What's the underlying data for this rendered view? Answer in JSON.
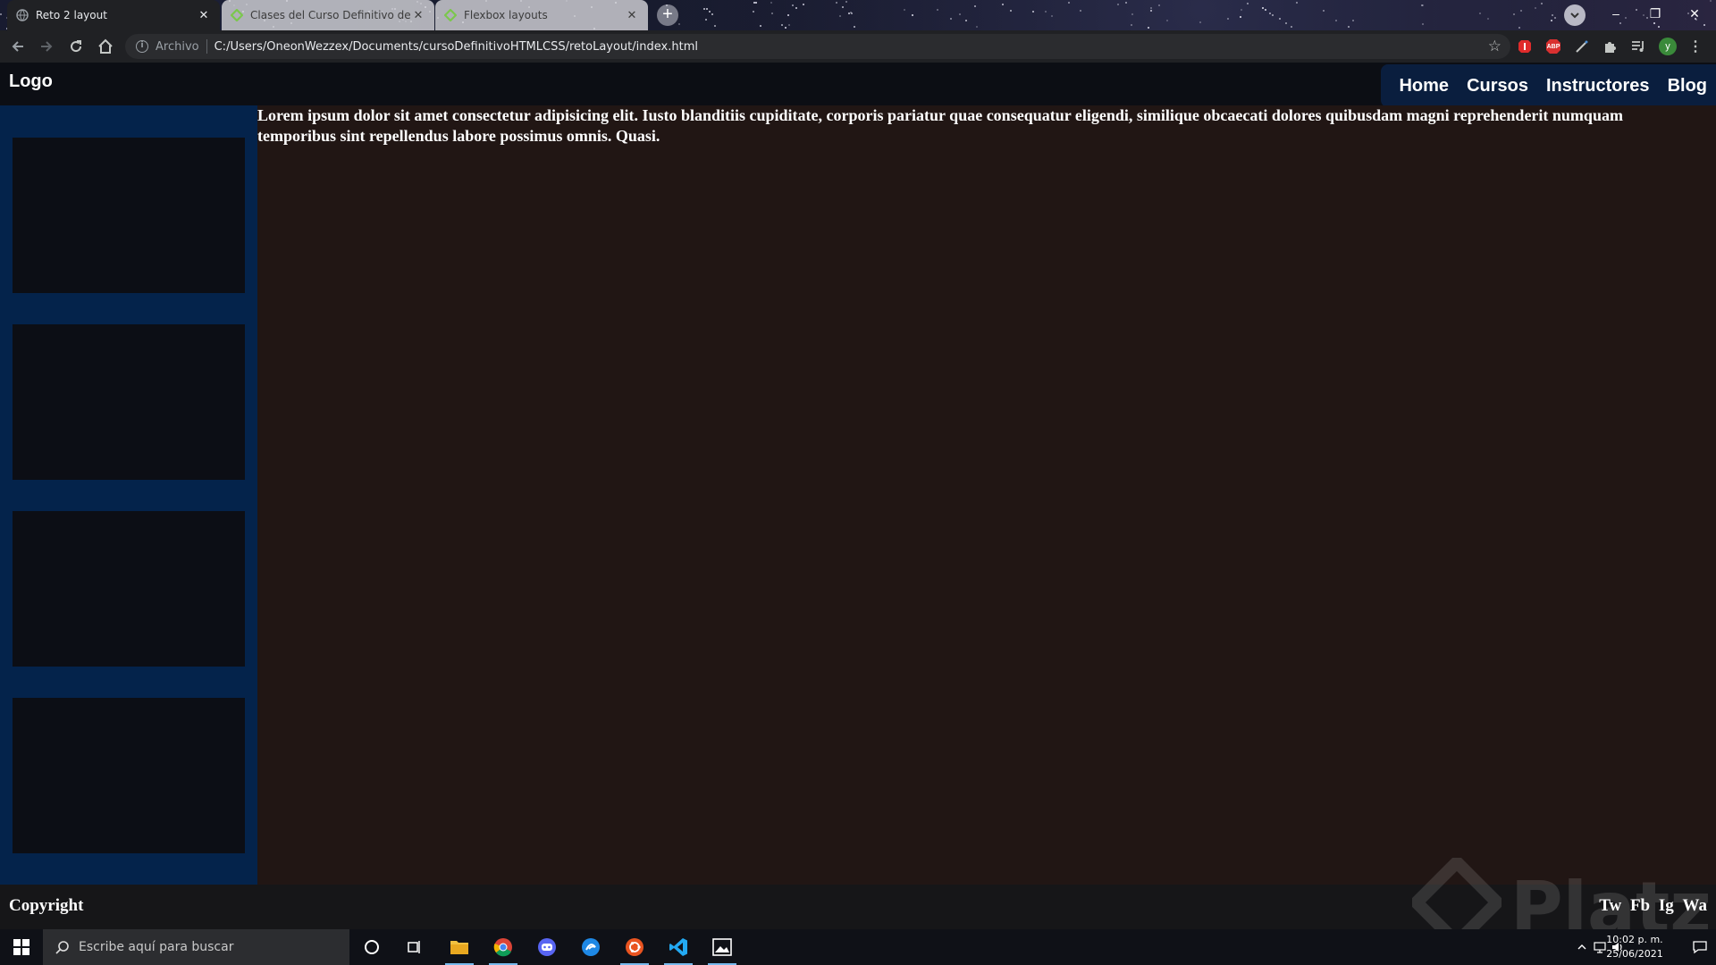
{
  "browser": {
    "tabs": [
      {
        "title": "Reto 2 layout",
        "active": true,
        "favicon": "globe-icon"
      },
      {
        "title": "Clases del Curso Definitivo de H",
        "active": false,
        "favicon": "platzi-icon"
      },
      {
        "title": "Flexbox layouts",
        "active": false,
        "favicon": "platzi-icon"
      }
    ],
    "address": {
      "scheme_label": "Archivo",
      "url": "C:/Users/OneonWezzex/Documents/cursoDefinitivoHTMLCSS/retoLayout/index.html"
    },
    "extensions": [
      "adblock-icon",
      "abp-icon",
      "wand-icon",
      "puzzle-icon",
      "media-icon",
      "profile-avatar"
    ],
    "profile_initial": "y",
    "extension_abp_label": "ABP"
  },
  "site": {
    "logo": "Logo",
    "nav": [
      "Home",
      "Cursos",
      "Instructores",
      "Blog"
    ],
    "article": "Lorem ipsum dolor sit amet consectetur adipisicing elit. Iusto blanditiis cupiditate, corporis pariatur quae consequatur eligendi, similique obcaecati dolores quibusdam magni reprehenderit numquam temporibus sint repellendus labore possimus omnis. Quasi.",
    "sidebar_box_count": 4,
    "footer": {
      "copyright": "Copyright",
      "socials": [
        "Tw",
        "Fb",
        "Ig",
        "Wa"
      ]
    },
    "watermark": "Platzi"
  },
  "taskbar": {
    "search_placeholder": "Escribe aquí para buscar",
    "apps": [
      "file-explorer-icon",
      "chrome-icon",
      "discord-icon",
      "edge-dev-icon",
      "ubuntu-icon",
      "vscode-icon",
      "photos-icon"
    ],
    "clock": {
      "time": "10:02 p. m.",
      "date": "25/06/2021"
    }
  },
  "colors": {
    "header_bg": "#0c0e14",
    "nav_bg": "#0a1e3e",
    "sidebar_bg": "#04234b",
    "sidebar_box": "#0c0e15",
    "main_bg": "#211614",
    "footer_bg": "#161618"
  }
}
